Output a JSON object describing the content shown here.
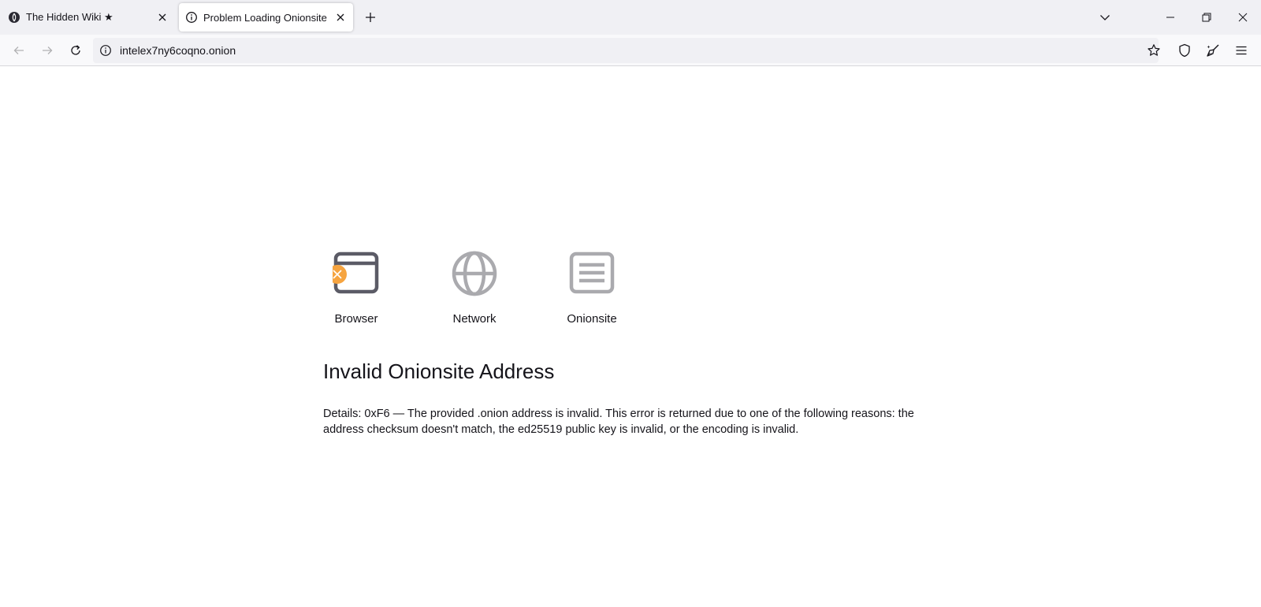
{
  "tabs": [
    {
      "title": "The Hidden Wiki ★",
      "favicon": "onion-icon",
      "active": false
    },
    {
      "title": "Problem Loading Onionsite",
      "favicon": "info-icon",
      "active": true
    }
  ],
  "toolbar": {
    "url": "intelex7ny6coqno.onion"
  },
  "diagnostics": [
    {
      "label": "Browser",
      "icon": "browser-window-icon",
      "status": "error"
    },
    {
      "label": "Network",
      "icon": "globe-icon",
      "status": "ok"
    },
    {
      "label": "Onionsite",
      "icon": "document-icon",
      "status": "ok"
    }
  ],
  "error": {
    "title": "Invalid Onionsite Address",
    "details": "Details: 0xF6 — The provided .onion address is invalid. This error is returned due to one of the following reasons: the address checksum doesn't match, the ed25519 public key is invalid, or the encoding is invalid."
  },
  "colors": {
    "error_badge": "#f6a440",
    "icon_dark": "#5b5b66",
    "icon_muted": "#aaaaae",
    "tabstrip_bg": "#f0f0f4"
  }
}
